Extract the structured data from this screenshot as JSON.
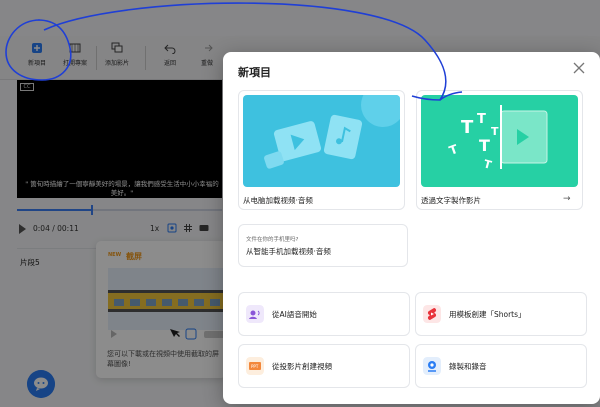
{
  "toolbar": {
    "new_project": "新項目",
    "open_project": "打開專案",
    "add_clip": "添加影片",
    "back": "返回",
    "redo": "重做"
  },
  "player": {
    "subtitle": "\" 箇旬時描繪了一個寧靜美好的場景，讓我們感受生活中小小幸福的美好。\"",
    "time": "0:04 / 00:11",
    "speed": "1x",
    "progress": 0.36
  },
  "clips": {
    "label": "片段5"
  },
  "tooltip": {
    "badge": "NEW",
    "title": "截屏",
    "text": "您可以下載或在視頻中使用截取的屏幕圖像!"
  },
  "modal": {
    "title": "新項目",
    "card_upload": "从电脑加载视频·音频",
    "card_text": "透過文字製作影片",
    "phone_question": "文件在你的手机里吗?",
    "phone_action": "从智能手机加载视频·音频",
    "opt_ai": "從AI語音開始",
    "opt_shorts": "用模板創建「Shorts」",
    "opt_ppt": "從投影片創建視頻",
    "opt_record": "錄製和錄音"
  },
  "colors": {
    "upload_bg": "#3ec1df",
    "text_bg": "#26d0a4",
    "accent": "#2a7df4",
    "annotation": "#1f3fd6"
  }
}
